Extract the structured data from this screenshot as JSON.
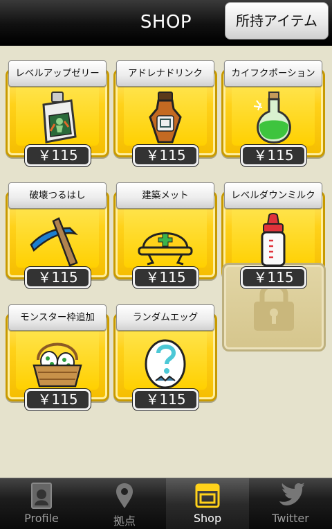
{
  "header": {
    "title": "SHOP",
    "owned_items_button": "所持アイテム"
  },
  "items": [
    {
      "name": "レベルアップゼリー",
      "price": "￥115",
      "icon": "jelly-pouch-icon"
    },
    {
      "name": "アドレナドリンク",
      "price": "￥115",
      "icon": "drink-bottle-icon"
    },
    {
      "name": "カイフクポーション",
      "price": "￥115",
      "icon": "green-potion-icon"
    },
    {
      "name": "破壊つるはし",
      "price": "￥115",
      "icon": "pickaxe-icon"
    },
    {
      "name": "建築メット",
      "price": "￥115",
      "icon": "hard-hat-icon"
    },
    {
      "name": "レベルダウンミルク",
      "price": "￥115",
      "icon": "milk-bottle-icon"
    },
    {
      "name": "モンスター枠追加",
      "price": "￥115",
      "icon": "egg-basket-icon"
    },
    {
      "name": "ランダムエッグ",
      "price": "￥115",
      "icon": "random-egg-icon"
    }
  ],
  "locked_slot": {
    "icon": "lock-icon"
  },
  "tabs": [
    {
      "label": "Profile",
      "icon": "profile-icon"
    },
    {
      "label": "拠点",
      "icon": "map-pin-icon"
    },
    {
      "label": "Shop",
      "icon": "shop-icon",
      "active": true
    },
    {
      "label": "Twitter",
      "icon": "twitter-bird-icon"
    }
  ],
  "colors": {
    "background": "#e5e2cc",
    "item_yellow": "#ffd21a",
    "header_black": "#111111"
  }
}
